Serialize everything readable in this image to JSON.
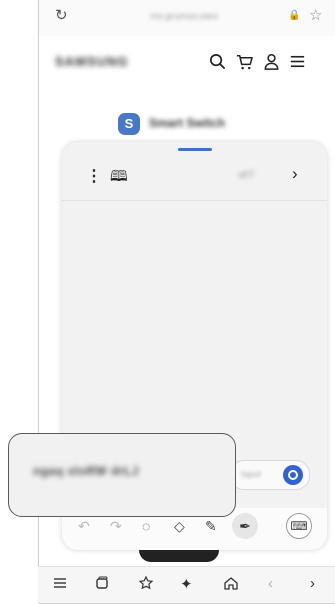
{
  "browser": {
    "url": "mo.gnumos.eara",
    "icons": [
      "reload-icon",
      "lock-icon",
      "star-icon"
    ]
  },
  "site": {
    "logo": "SAMSUNG",
    "header_icons": [
      "search-icon",
      "cart-icon",
      "user-icon",
      "menu-icon"
    ]
  },
  "smartswitch": {
    "logo_glyph": "S",
    "label": "Smart Switch"
  },
  "notes_panel": {
    "more_glyph": "⋮",
    "book_glyph": "🕮",
    "title": "ol/T",
    "next_glyph": "›",
    "input_hint": "Iaput",
    "toolbar_icons": [
      "undo-icon",
      "redo-icon",
      "lasso-icon",
      "eraser-icon",
      "highlighter-icon",
      "pen-icon",
      "keyboard-icon"
    ]
  },
  "callout": {
    "text": "ngaq sloRW  drLJ"
  },
  "nav_bar": {
    "icons": [
      "menu-icon",
      "tabs-icon",
      "bookmark-icon",
      "sparkle-icon",
      "home-icon",
      "back-icon",
      "forward-icon"
    ]
  },
  "colors": {
    "accent": "#3f6fd1",
    "send_button": "#2f63d4",
    "smartswitch": "#4a78c8"
  }
}
